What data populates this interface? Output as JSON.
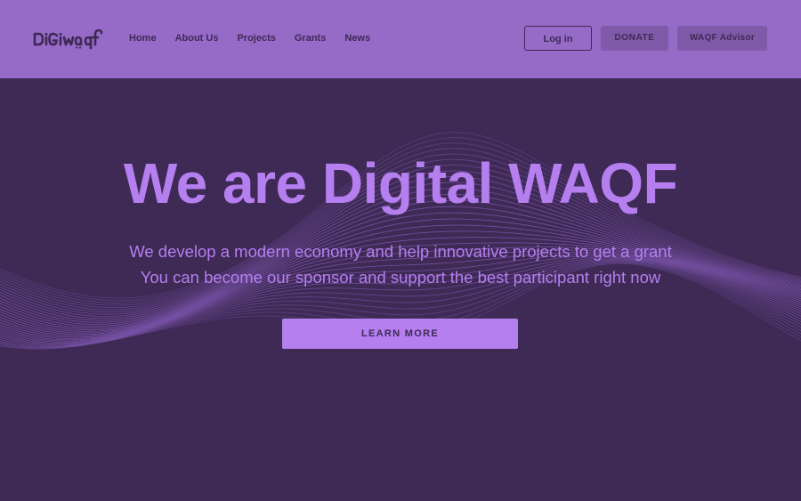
{
  "brand": {
    "logo_text": "DIGIWAQF",
    "colors": {
      "header_bg": "#966ac7",
      "hero_bg": "#3e2a55",
      "accent": "#b57ff0",
      "button_muted": "#7f5aa8",
      "dark_text": "#3e2a55"
    }
  },
  "header": {
    "nav": [
      {
        "label": "Home"
      },
      {
        "label": "About Us"
      },
      {
        "label": "Projects"
      },
      {
        "label": "Grants"
      },
      {
        "label": "News"
      }
    ],
    "login_label": "Log in",
    "donate_label": "DONATE",
    "advisor_label": "WAQF Advisor"
  },
  "hero": {
    "title": "We are Digital WAQF",
    "subtitle_lines": [
      "We develop a modern economy and help innovative projects to get a grant",
      "You can become our sponsor and support the best participant right now"
    ],
    "cta_label": "LEARN MORE"
  }
}
